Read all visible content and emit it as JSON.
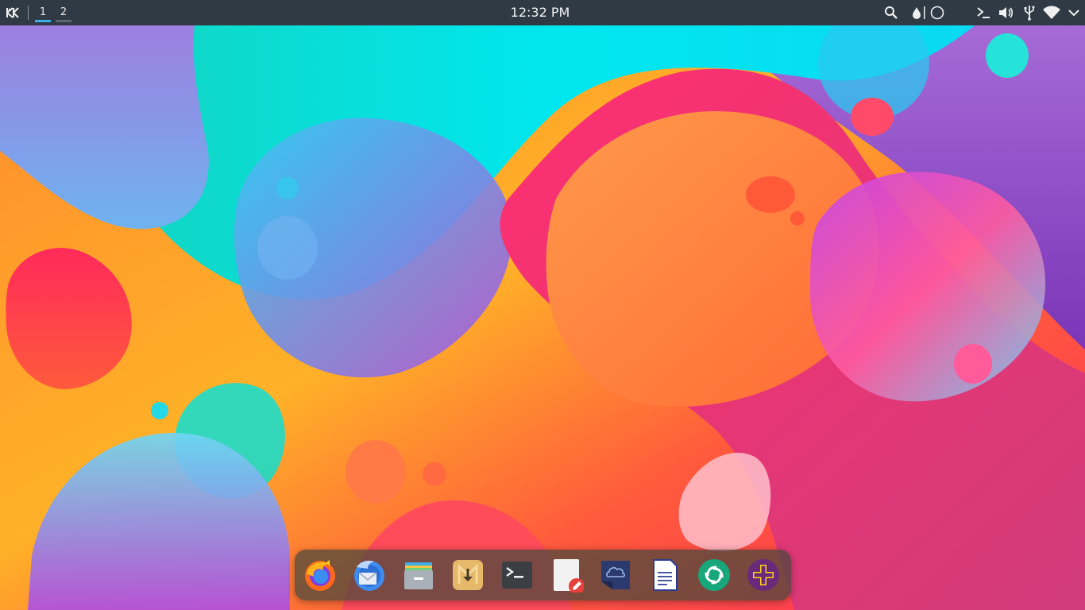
{
  "topbar": {
    "virtual_desktops": [
      {
        "label": "1",
        "active": true
      },
      {
        "label": "2",
        "active": false
      }
    ],
    "clock": "12:32 PM",
    "tray_icons": [
      "search-icon",
      "color-picker-icon",
      "night-mode-icon",
      "terminal-icon",
      "volume-icon",
      "usb-icon",
      "wifi-icon"
    ]
  },
  "dock": {
    "apps": [
      {
        "name": "firefox",
        "icon": "firefox-icon"
      },
      {
        "name": "thunderbird",
        "icon": "thunderbird-icon"
      },
      {
        "name": "file-manager",
        "icon": "file-manager-icon"
      },
      {
        "name": "downloader",
        "icon": "downloader-icon"
      },
      {
        "name": "terminal",
        "icon": "terminal-icon"
      },
      {
        "name": "text-editor",
        "icon": "text-editor-icon"
      },
      {
        "name": "cloud-sync",
        "icon": "cloud-icon"
      },
      {
        "name": "document-writer",
        "icon": "document-icon"
      },
      {
        "name": "element-chat",
        "icon": "element-icon"
      },
      {
        "name": "add-app",
        "icon": "plus-icon"
      }
    ]
  },
  "colors": {
    "panel": "#2f3a44",
    "active_desktop": "#3daee9",
    "cyan": "#00e5f0",
    "magenta": "#c040e0",
    "coral": "#ff6b45"
  }
}
